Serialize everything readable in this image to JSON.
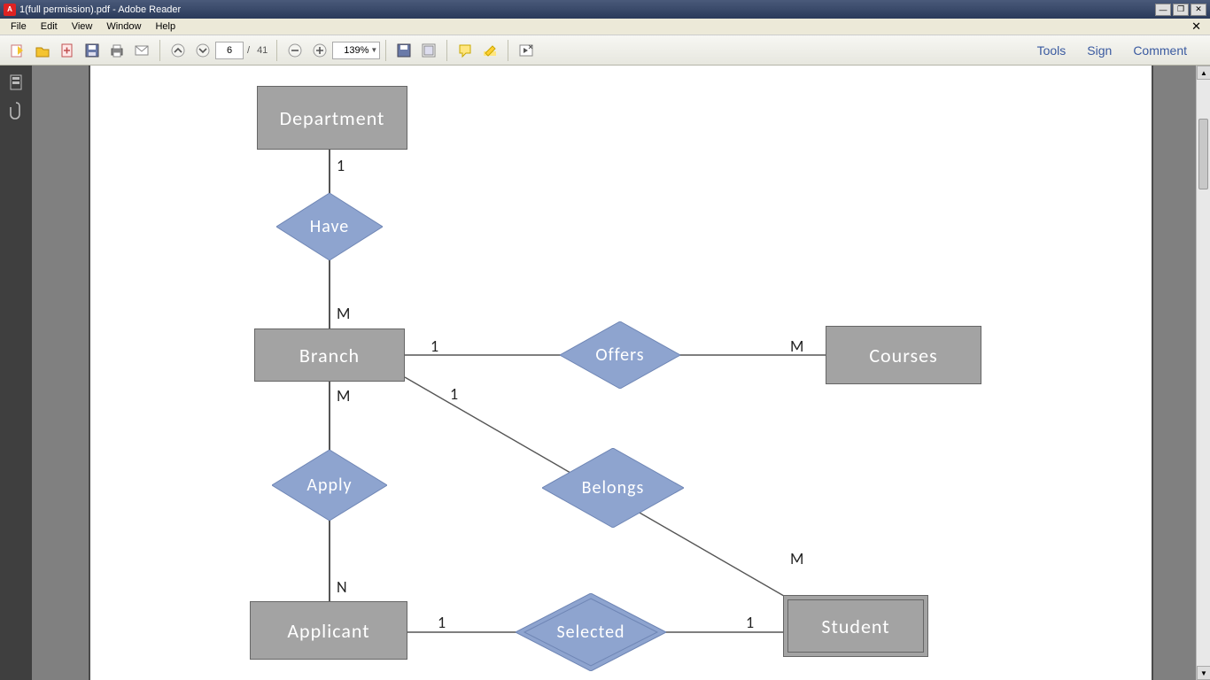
{
  "title": "1(full permission).pdf - Adobe Reader",
  "menus": {
    "file": "File",
    "edit": "Edit",
    "view": "View",
    "window": "Window",
    "help": "Help"
  },
  "toolbar": {
    "page_current": "6",
    "page_sep": "/",
    "page_total": "41",
    "zoom": "139%"
  },
  "right_tools": {
    "tools": "Tools",
    "sign": "Sign",
    "comment": "Comment"
  },
  "diagram": {
    "entities": {
      "department": "Department",
      "branch": "Branch",
      "courses": "Courses",
      "applicant": "Applicant",
      "student": "Student"
    },
    "relations": {
      "have": "Have",
      "offers": "Offers",
      "apply": "Apply",
      "belongs": "Belongs",
      "selected": "Selected"
    },
    "cards": {
      "dep_have": "1",
      "have_branch": "M",
      "branch_offers": "1",
      "offers_courses": "M",
      "branch_apply": "M",
      "apply_applicant": "N",
      "branch_belongs": "1",
      "belongs_student": "M",
      "applicant_selected": "1",
      "selected_student": "1"
    }
  }
}
